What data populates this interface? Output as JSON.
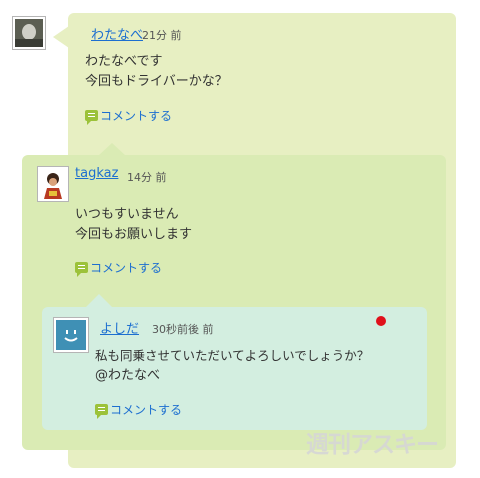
{
  "comments": [
    {
      "user": "わたなべ",
      "time": "21分 前",
      "lines": [
        "わたなべです",
        "今回もドライバーかな？"
      ],
      "comment_label": "コメントする"
    },
    {
      "user": "tagkaz",
      "time": "14分 前",
      "lines": [
        "いつもすいません",
        "今回もお願いします"
      ],
      "comment_label": "コメントする"
    },
    {
      "user": "よしだ",
      "time": "30秒前後 前",
      "lines": [
        "私も同乗させていただいてよろしいでしょうか？",
        "@わたなべ"
      ],
      "comment_label": "コメントする"
    }
  ],
  "watermark": "週刊アスキー",
  "colors": {
    "bubble1": "#e7efc2",
    "bubble2": "#daebb4",
    "bubble3": "#d3eee0",
    "link": "#1d6fd0",
    "unread_dot": "#e0101a"
  }
}
